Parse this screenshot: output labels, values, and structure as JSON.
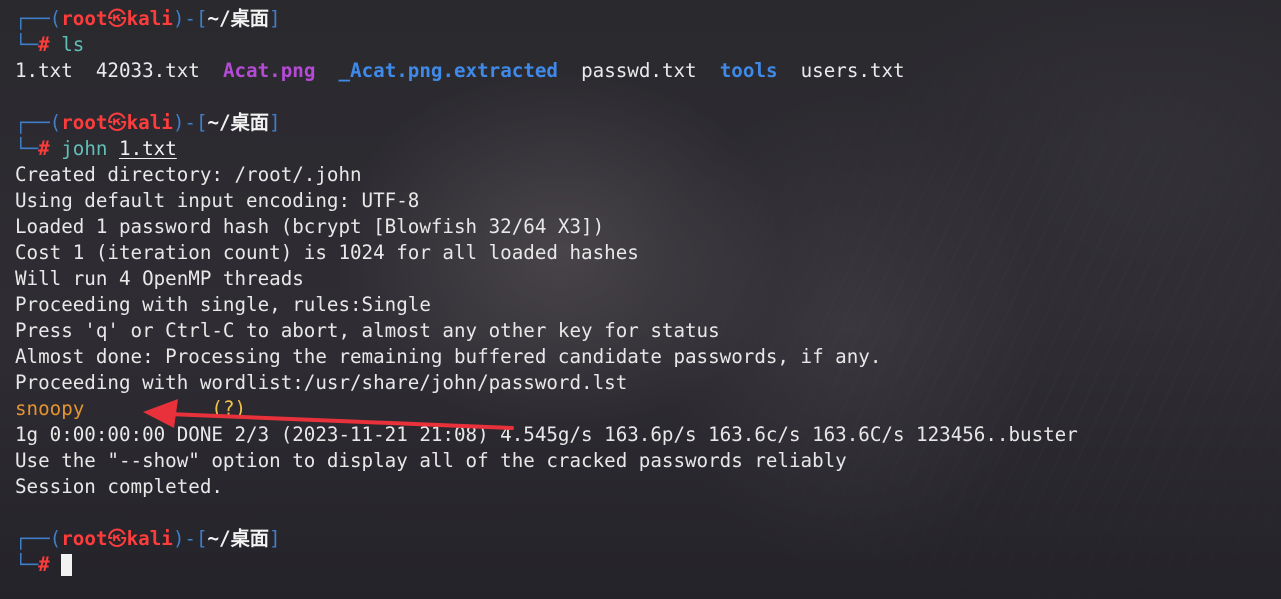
{
  "prompt": {
    "user": "root",
    "separator_icon": "skull-icon",
    "separator_glyph": "㉿",
    "host": "kali",
    "cwd": "~/桌面",
    "symbol": "#"
  },
  "blocks": [
    {
      "command": "ls",
      "ls_entries": [
        {
          "name": "1.txt",
          "kind": "file"
        },
        {
          "name": "42033.txt",
          "kind": "file"
        },
        {
          "name": "Acat.png",
          "kind": "image"
        },
        {
          "name": "_Acat.png.extracted",
          "kind": "directory"
        },
        {
          "name": "passwd.txt",
          "kind": "file"
        },
        {
          "name": "tools",
          "kind": "directory"
        },
        {
          "name": "users.txt",
          "kind": "file"
        }
      ]
    },
    {
      "command": "john",
      "command_arg": "1.txt",
      "output": [
        "Created directory: /root/.john",
        "Using default input encoding: UTF-8",
        "Loaded 1 password hash (bcrypt [Blowfish 32/64 X3])",
        "Cost 1 (iteration count) is 1024 for all loaded hashes",
        "Will run 4 OpenMP threads",
        "Proceeding with single, rules:Single",
        "Press 'q' or Ctrl-C to abort, almost any other key for status",
        "Almost done: Processing the remaining buffered candidate passwords, if any.",
        "Proceeding with wordlist:/usr/share/john/password.lst"
      ],
      "cracked": {
        "password": "snoopy",
        "user_label": "(?)"
      },
      "output_after": [
        "1g 0:00:00:00 DONE 2/3 (2023-11-21 21:08) 4.545g/s 163.6p/s 163.6c/s 163.6C/s 123456..buster",
        "Use the \"--show\" option to display all of the cracked passwords reliably",
        "Session completed."
      ]
    }
  ],
  "colors": {
    "prompt_frame": "#3f7ec9",
    "user_host": "#ff3c3c",
    "command": "#5fc0b8",
    "image_file": "#b44ad6",
    "directory": "#3f8ae8",
    "cracked_password": "#e39430",
    "annotation_arrow": "#e8313a"
  }
}
